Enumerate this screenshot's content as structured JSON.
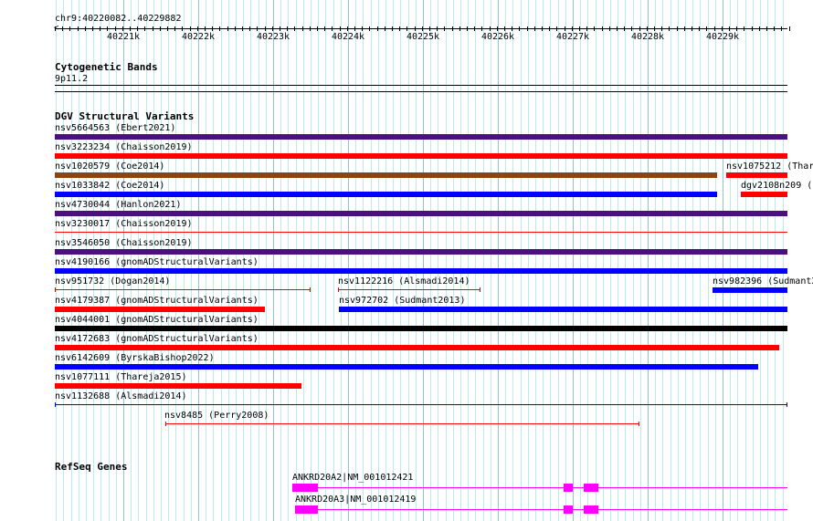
{
  "ruler": {
    "location": "chr9:40220082..40229882",
    "ticks": [
      "40221k",
      "40222k",
      "40223k",
      "40224k",
      "40225k",
      "40226k",
      "40227k",
      "40228k",
      "40229k"
    ]
  },
  "cytobands": {
    "title": "Cytogenetic Bands",
    "band": "9p11.2"
  },
  "dgv": {
    "title": "DGV Structural Variants",
    "features": [
      {
        "label": "nsv5664563 (Ebert2021)",
        "color": "#4b1080"
      },
      {
        "label": "nsv3223234 (Chaisson2019)",
        "color": "#ff0000"
      },
      {
        "label": "nsv1020579 (Coe2014)",
        "color": "#8b4513"
      },
      {
        "label": "nsv1075212 (Thar",
        "color": "#ff0000"
      },
      {
        "label": "nsv1033842 (Coe2014)",
        "color": "#0000ff"
      },
      {
        "label": "dgv2108n209 (",
        "color": "#ff0000"
      },
      {
        "label": "nsv4730044 (Hanlon2021)",
        "color": "#4b1080"
      },
      {
        "label": "nsv3230017 (Chaisson2019)",
        "color": "#ff0000"
      },
      {
        "label": "nsv3546050 (Chaisson2019)",
        "color": "#4b1080"
      },
      {
        "label": "nsv4190166 (gnomADStructuralVariants)",
        "color": "#0000ff"
      },
      {
        "label": "nsv951732 (Dogan2014)",
        "color": "#ff0000"
      },
      {
        "label": "nsv1122216 (Alsmadi2014)",
        "color": "#ff0000"
      },
      {
        "label": "nsv982396 (Sudmant2",
        "color": "#0000ff"
      },
      {
        "label": "nsv4179387 (gnomADStructuralVariants)",
        "color": "#ff0000"
      },
      {
        "label": "nsv972702 (Sudmant2013)",
        "color": "#0000ff"
      },
      {
        "label": "nsv4044001 (gnomADStructuralVariants)",
        "color": "#000000"
      },
      {
        "label": "nsv4172683 (gnomADStructuralVariants)",
        "color": "#ff0000"
      },
      {
        "label": "nsv6142609 (ByrskaBishop2022)",
        "color": "#0000ff"
      },
      {
        "label": "nsv1077111 (Thareja2015)",
        "color": "#ff0000"
      },
      {
        "label": "nsv1132688 (Alsmadi2014)",
        "color": "#0000ff"
      },
      {
        "label": "nsv8485 (Perry2008)",
        "color": "#ff0000"
      }
    ]
  },
  "refseq": {
    "title": "RefSeq Genes",
    "genes": [
      {
        "label": "ANKRD20A2|NM_001012421"
      },
      {
        "label": "ANKRD20A3|NM_001012419"
      }
    ]
  }
}
